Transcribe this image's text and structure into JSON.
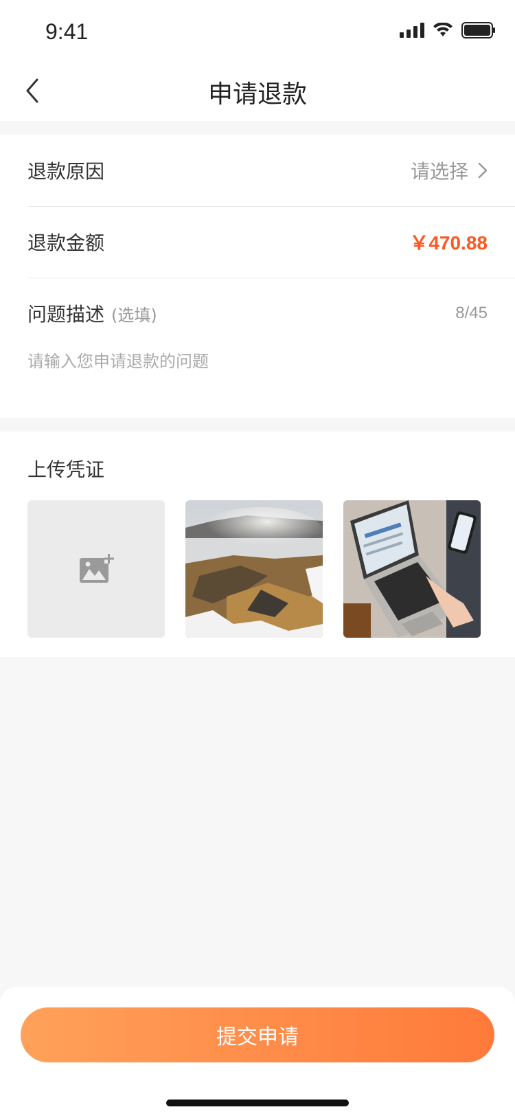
{
  "status": {
    "time": "9:41"
  },
  "nav": {
    "title": "申请退款"
  },
  "form": {
    "reason_label": "退款原因",
    "reason_placeholder": "请选择",
    "amount_label": "退款金额",
    "amount_value": "￥470.88",
    "desc_label": "问题描述",
    "desc_optional": "(选填)",
    "desc_counter": "8/45",
    "desc_placeholder": "请输入您申请退款的问题"
  },
  "upload": {
    "title": "上传凭证",
    "add_icon": "add-image-icon",
    "photos": [
      "geothermal-landscape",
      "laptop-and-phone"
    ]
  },
  "footer": {
    "submit_label": "提交申请"
  },
  "colors": {
    "accent": "#ff5722",
    "button_start": "#ffa15a",
    "button_end": "#ff7a3a"
  }
}
